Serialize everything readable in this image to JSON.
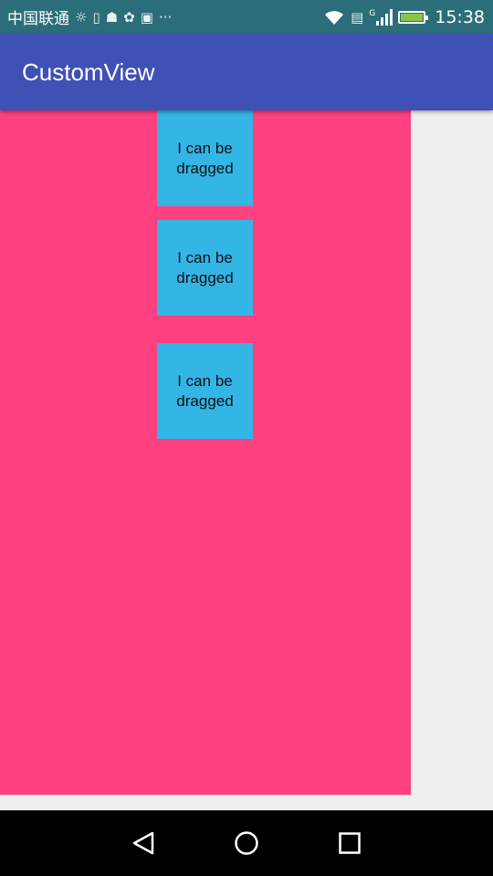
{
  "status_bar": {
    "carrier": "中国联通",
    "icons": [
      "brightness-icon",
      "sim-icon",
      "android-icon",
      "bird-icon",
      "bag-icon",
      "more-icon"
    ],
    "more": "···",
    "network_type": "G",
    "battery_fraction": 0.9,
    "time": "15:38"
  },
  "app_bar": {
    "title": "CustomView"
  },
  "boxes": [
    {
      "label_line1": "I can be",
      "label_line2": "dragged"
    },
    {
      "label_line1": "I can be",
      "label_line2": "dragged"
    },
    {
      "label_line1": "I can be",
      "label_line2": "dragged"
    }
  ],
  "colors": {
    "app_bar": "#3f51b5",
    "canvas": "#ff4081",
    "box": "#33b5e5",
    "background": "#eeeeee"
  },
  "nav_bar": {
    "buttons": [
      "back-icon",
      "home-icon",
      "recents-icon"
    ]
  }
}
